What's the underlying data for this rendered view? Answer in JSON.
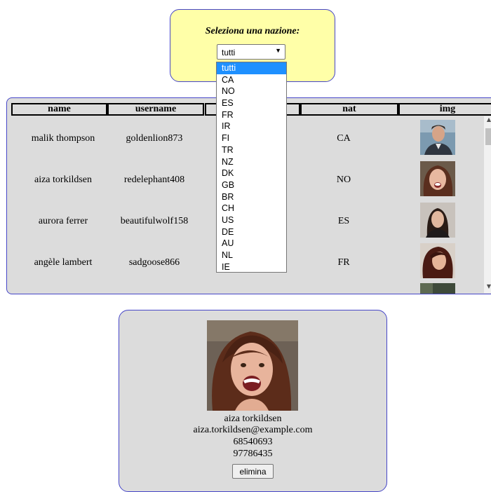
{
  "selector": {
    "title": "Seleziona una nazione:",
    "selected": "tutti",
    "options": [
      "tutti",
      "CA",
      "NO",
      "ES",
      "FR",
      "IR",
      "FI",
      "TR",
      "NZ",
      "DK",
      "GB",
      "BR",
      "CH",
      "US",
      "DE",
      "AU",
      "NL",
      "IE"
    ]
  },
  "table": {
    "headers": [
      "name",
      "username",
      "",
      "nat",
      "img"
    ],
    "rows": [
      {
        "name": "malik thompson",
        "username": "goldenlion873",
        "nat": "CA"
      },
      {
        "name": "aiza torkildsen",
        "username": "redelephant408",
        "nat": "NO"
      },
      {
        "name": "aurora ferrer",
        "username": "beautifulwolf158",
        "nat": "ES"
      },
      {
        "name": "angèle lambert",
        "username": "sadgoose866",
        "nat": "FR"
      }
    ]
  },
  "detail": {
    "name": "aiza torkildsen",
    "email": "aiza.torkildsen@example.com",
    "phone": "68540693",
    "cell": "97786435",
    "delete_label": "elimina"
  },
  "colors": {
    "selector_bg": "#ffffa8",
    "panel_bg": "#dcdcdc",
    "border": "#4646c8",
    "highlight": "#1e90ff"
  }
}
